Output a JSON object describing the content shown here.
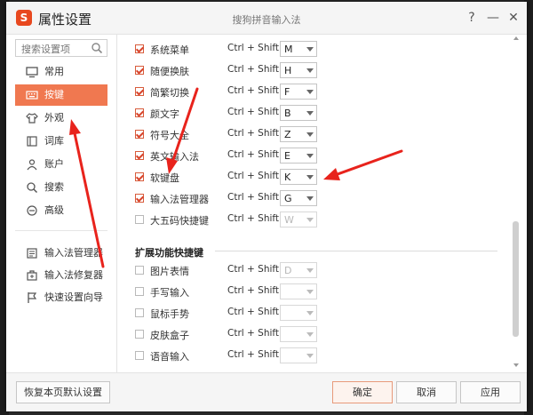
{
  "window": {
    "title": "属性设置",
    "subtitle": "搜狗拼音输入法",
    "help": "?",
    "minimize": "—",
    "close": "✕",
    "logo_char": "S"
  },
  "sidebar": {
    "search_placeholder": "搜索设置项",
    "items": [
      {
        "label": "常用",
        "icon": "monitor-icon"
      },
      {
        "label": "按键",
        "icon": "keyboard-icon"
      },
      {
        "label": "外观",
        "icon": "shirt-icon"
      },
      {
        "label": "词库",
        "icon": "book-icon"
      },
      {
        "label": "账户",
        "icon": "user-icon"
      },
      {
        "label": "搜索",
        "icon": "search-icon"
      },
      {
        "label": "高级",
        "icon": "advanced-icon"
      }
    ],
    "active_item": "按键",
    "tools": [
      {
        "label": "输入法管理器",
        "icon": "manager-icon"
      },
      {
        "label": "输入法修复器",
        "icon": "repair-icon"
      },
      {
        "label": "快速设置向导",
        "icon": "flag-icon"
      }
    ]
  },
  "shortcuts": [
    {
      "label": "系统菜单",
      "combo": "Ctrl + Shift +",
      "key": "M",
      "checked": true
    },
    {
      "label": "随便换肤",
      "combo": "Ctrl + Shift +",
      "key": "H",
      "checked": true
    },
    {
      "label": "简繁切换",
      "combo": "Ctrl + Shift +",
      "key": "F",
      "checked": true
    },
    {
      "label": "颜文字",
      "combo": "Ctrl + Shift +",
      "key": "B",
      "checked": true
    },
    {
      "label": "符号大全",
      "combo": "Ctrl + Shift +",
      "key": "Z",
      "checked": true
    },
    {
      "label": "英文输入法",
      "combo": "Ctrl + Shift +",
      "key": "E",
      "checked": true
    },
    {
      "label": "软键盘",
      "combo": "Ctrl + Shift +",
      "key": "K",
      "checked": true
    },
    {
      "label": "输入法管理器",
      "combo": "Ctrl + Shift +",
      "key": "G",
      "checked": true
    },
    {
      "label": "大五码快捷键",
      "combo": "Ctrl + Shift +",
      "key": "W",
      "checked": false
    }
  ],
  "extended": {
    "section_title": "扩展功能快捷键",
    "items": [
      {
        "label": "图片表情",
        "combo": "Ctrl + Shift +",
        "key": "D",
        "checked": false
      },
      {
        "label": "手写输入",
        "combo": "Ctrl + Shift +",
        "key": "",
        "checked": false
      },
      {
        "label": "鼠标手势",
        "combo": "Ctrl + Shift +",
        "key": "",
        "checked": false
      },
      {
        "label": "皮肤盒子",
        "combo": "Ctrl + Shift +",
        "key": "",
        "checked": false
      },
      {
        "label": "语音输入",
        "combo": "Ctrl + Shift +",
        "key": "",
        "checked": false
      }
    ]
  },
  "footer": {
    "restore_label": "恢复本页默认设置",
    "ok_label": "确定",
    "cancel_label": "取消",
    "apply_label": "应用"
  },
  "colors": {
    "accent": "#f07850",
    "checkmark": "#d8452c",
    "annotation_arrow": "#e8231c"
  }
}
